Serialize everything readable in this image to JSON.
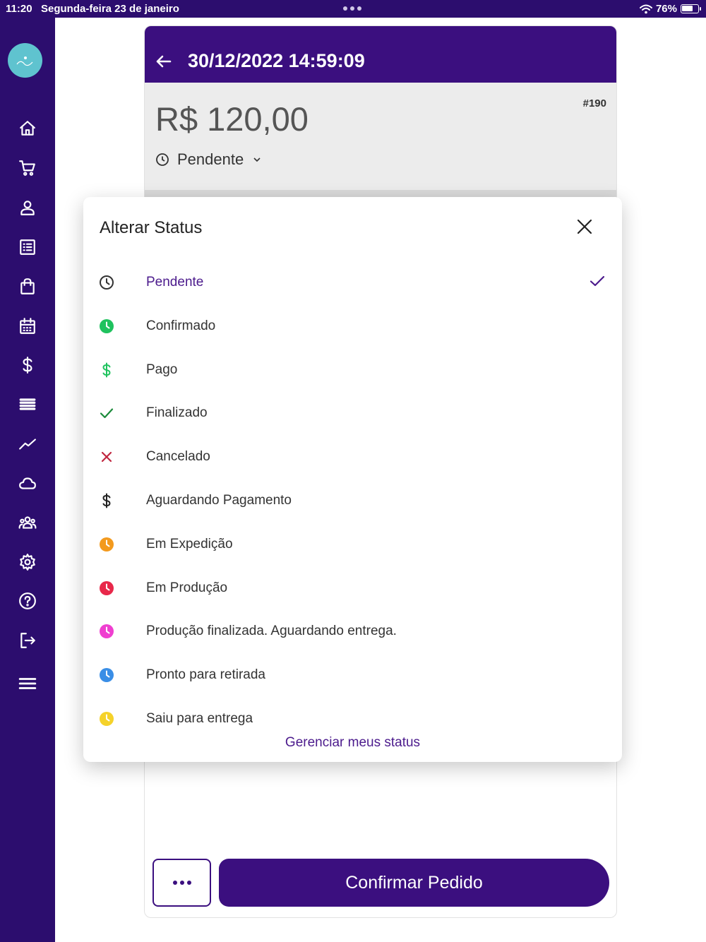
{
  "status_bar": {
    "time": "11:20",
    "date": "Segunda-feira 23 de janeiro",
    "battery_percent": "76%",
    "battery_level": 0.76
  },
  "sidebar": {
    "items": [
      {
        "name": "home-icon"
      },
      {
        "name": "cart-icon"
      },
      {
        "name": "user-icon"
      },
      {
        "name": "list-icon"
      },
      {
        "name": "bag-icon"
      },
      {
        "name": "calendar-icon"
      },
      {
        "name": "dollar-icon"
      },
      {
        "name": "stack-icon"
      },
      {
        "name": "chart-icon"
      },
      {
        "name": "cloud-icon"
      },
      {
        "name": "group-icon"
      },
      {
        "name": "gear-icon"
      },
      {
        "name": "help-icon"
      },
      {
        "name": "logout-icon"
      },
      {
        "name": "menu-icon"
      }
    ]
  },
  "order": {
    "title": "30/12/2022 14:59:09",
    "number": "#190",
    "amount": "R$ 120,00",
    "status": "Pendente",
    "confirm_label": "Confirmar Pedido"
  },
  "modal": {
    "title": "Alterar Status",
    "manage_label": "Gerenciar meus status",
    "items": [
      {
        "label": "Pendente",
        "icon": "clock-outline-icon",
        "color": "#333333",
        "selected": true
      },
      {
        "label": "Confirmado",
        "icon": "clock-filled-icon",
        "color": "#1fc25e"
      },
      {
        "label": "Pago",
        "icon": "dollar-icon",
        "color": "#1fc25e"
      },
      {
        "label": "Finalizado",
        "icon": "check-icon",
        "color": "#1a8a3a"
      },
      {
        "label": "Cancelado",
        "icon": "x-icon",
        "color": "#c0263f"
      },
      {
        "label": "Aguardando Pagamento",
        "icon": "dollar-icon",
        "color": "#222222"
      },
      {
        "label": "Em Expedição",
        "icon": "clock-filled-icon",
        "color": "#f39a1e"
      },
      {
        "label": "Em Produção",
        "icon": "clock-filled-icon",
        "color": "#e8284a"
      },
      {
        "label": "Produção finalizada. Aguardando entrega.",
        "icon": "clock-filled-icon",
        "color": "#ef3fd0"
      },
      {
        "label": "Pronto para retirada",
        "icon": "clock-filled-icon",
        "color": "#3a8ee6"
      },
      {
        "label": "Saiu para entrega",
        "icon": "clock-filled-icon",
        "color": "#f5d22a"
      }
    ]
  }
}
